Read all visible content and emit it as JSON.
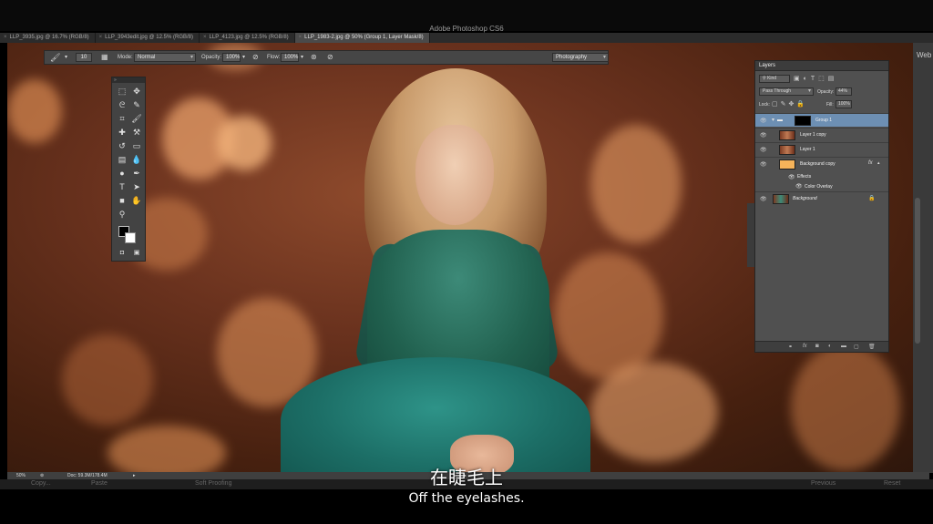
{
  "app": {
    "title": "Adobe Photoshop CS6"
  },
  "tabs": [
    {
      "label": "LLP_3935.jpg @ 16.7% (RGB/8)",
      "active": false
    },
    {
      "label": "LLP_3943edit.jpg @ 12.5% (RGB/8)",
      "active": false
    },
    {
      "label": "LLP_4123.jpg @ 12.5% (RGB/8)",
      "active": false
    },
    {
      "label": "LLP_1983-2.jpg @ 50% (Group 1, Layer Mask/8)",
      "active": true
    }
  ],
  "options_bar": {
    "brush_size": "10",
    "mode_label": "Mode:",
    "mode_value": "Normal",
    "opacity_label": "Opacity:",
    "opacity_value": "100%",
    "flow_label": "Flow:",
    "flow_value": "100%",
    "workspace": "Photography"
  },
  "tools_panel": {
    "tools": [
      {
        "icon": "marquee-icon",
        "glyph": "⬚"
      },
      {
        "icon": "move-icon",
        "glyph": "✥"
      },
      {
        "icon": "lasso-icon",
        "glyph": "ᘓ"
      },
      {
        "icon": "quick-select-icon",
        "glyph": "✎"
      },
      {
        "icon": "crop-icon",
        "glyph": "⌗"
      },
      {
        "icon": "brush-icon",
        "glyph": "🖌"
      },
      {
        "icon": "spot-heal-icon",
        "glyph": "✚"
      },
      {
        "icon": "clone-stamp-icon",
        "glyph": "⚒"
      },
      {
        "icon": "history-brush-icon",
        "glyph": "↺"
      },
      {
        "icon": "eraser-icon",
        "glyph": "▭"
      },
      {
        "icon": "gradient-icon",
        "glyph": "▤"
      },
      {
        "icon": "blur-icon",
        "glyph": "💧"
      },
      {
        "icon": "dodge-icon",
        "glyph": "●"
      },
      {
        "icon": "pen-icon",
        "glyph": "✒"
      },
      {
        "icon": "type-icon",
        "glyph": "T"
      },
      {
        "icon": "path-select-icon",
        "glyph": "➤"
      },
      {
        "icon": "shape-icon",
        "glyph": "■"
      },
      {
        "icon": "hand-icon",
        "glyph": "✋"
      },
      {
        "icon": "zoom-icon",
        "glyph": "⚲"
      }
    ]
  },
  "layers_panel": {
    "tab": "Layers",
    "kind": "Kind",
    "blend_mode": "Pass Through",
    "opacity_label": "Opacity:",
    "opacity_value": "44%",
    "lock_label": "Lock:",
    "fill_label": "Fill:",
    "fill_value": "100%",
    "layers": [
      {
        "name": "Group 1",
        "selected": true
      },
      {
        "name": "Layer 1 copy",
        "selected": false
      },
      {
        "name": "Layer 1",
        "selected": false
      },
      {
        "name": "Background copy",
        "selected": false,
        "fx": "fx"
      },
      {
        "name": "Effects",
        "selected": false
      },
      {
        "name": "Color Overlay",
        "selected": false
      },
      {
        "name": "Background",
        "selected": false
      }
    ]
  },
  "status_bar": {
    "zoom": "50%",
    "doc": "Doc: 59.3M/178.4M"
  },
  "bottom_bar": {
    "copy": "Copy...",
    "paste": "Paste",
    "soft_proofing": "Soft Proofing",
    "previous": "Previous",
    "reset": "Reset"
  },
  "right_edge": {
    "label": "Web"
  },
  "subtitles": {
    "chinese": "在睫毛上",
    "english": "Off the eyelashes."
  },
  "colors": {
    "selection": "#6d8fb3",
    "panel": "#505050",
    "subtitle": "#ffffff"
  }
}
